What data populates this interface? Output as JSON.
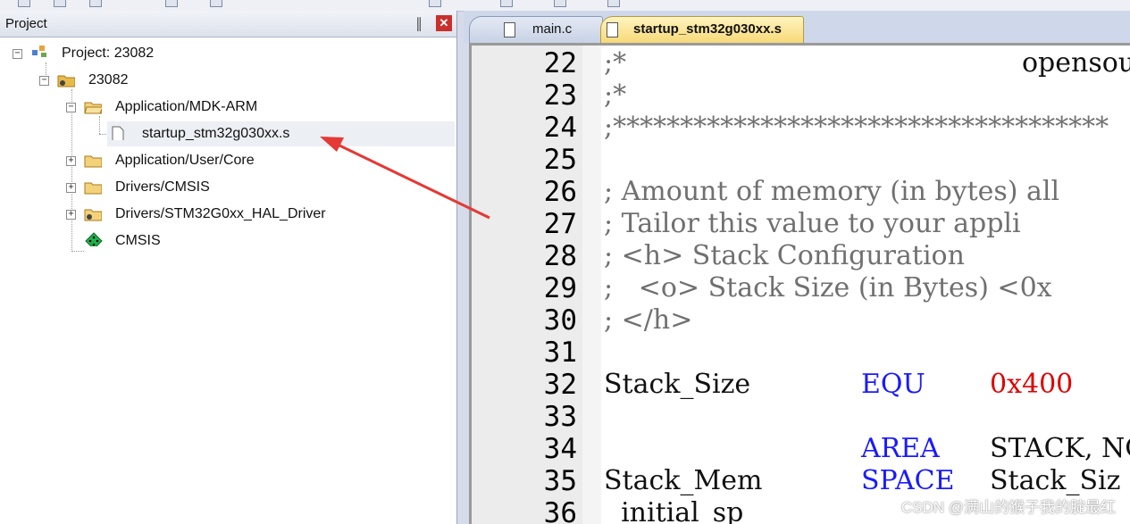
{
  "project_panel": {
    "title": "Project",
    "pin_glyph": "║",
    "close_glyph": "✕",
    "tree": [
      {
        "label": "Project: 23082",
        "icon": "project-icon"
      },
      {
        "label": "23082",
        "icon": "target-folder-icon"
      },
      {
        "label": "Application/MDK-ARM",
        "icon": "open-folder-icon"
      },
      {
        "label": "startup_stm32g030xx.s",
        "icon": "file-icon"
      },
      {
        "label": "Application/User/Core",
        "icon": "folder-icon"
      },
      {
        "label": "Drivers/CMSIS",
        "icon": "folder-icon"
      },
      {
        "label": "Drivers/STM32G0xx_HAL_Driver",
        "icon": "folder-gear-icon"
      },
      {
        "label": "CMSIS",
        "icon": "cmsis-diamond-icon"
      }
    ],
    "expanders": {
      "collapse": "−",
      "expand": "+"
    }
  },
  "editor": {
    "tabs": [
      {
        "label": "main.c",
        "active": false
      },
      {
        "label": "startup_stm32g030xx.s",
        "active": true
      }
    ],
    "lines": [
      {
        "no": "22",
        "parts": [
          ";*",
          "",
          "",
          "opensou"
        ]
      },
      {
        "no": "23",
        "parts": [
          ";*",
          "",
          "",
          ""
        ]
      },
      {
        "no": "24",
        "parts": [
          ";*************************************",
          "",
          "",
          ""
        ]
      },
      {
        "no": "25",
        "parts": [
          "",
          "",
          "",
          ""
        ]
      },
      {
        "no": "26",
        "parts": [
          "; Amount of memory (in bytes) all",
          "",
          "",
          ""
        ]
      },
      {
        "no": "27",
        "parts": [
          "; Tailor this value to your appli",
          "",
          "",
          ""
        ]
      },
      {
        "no": "28",
        "parts": [
          "; <h> Stack Configuration",
          "",
          "",
          ""
        ]
      },
      {
        "no": "29",
        "parts": [
          ";   <o> Stack Size (in Bytes) <0x",
          "",
          "",
          ""
        ]
      },
      {
        "no": "30",
        "parts": [
          "; </h>",
          "",
          "",
          ""
        ]
      },
      {
        "no": "31",
        "parts": [
          "",
          "",
          "",
          ""
        ]
      },
      {
        "no": "32",
        "parts": [
          "Stack_Size",
          "EQU",
          "0x400",
          ""
        ]
      },
      {
        "no": "33",
        "parts": [
          "",
          "",
          "",
          ""
        ]
      },
      {
        "no": "34",
        "parts": [
          "",
          "AREA",
          "STACK, NO",
          ""
        ]
      },
      {
        "no": "35",
        "parts": [
          "Stack_Mem",
          "SPACE",
          "Stack_Siz",
          ""
        ]
      },
      {
        "no": "36",
        "parts": [
          "  initial_sp",
          "",
          "",
          ""
        ]
      }
    ],
    "colors": {
      "comment": "#707070",
      "keyword": "#1a1aff",
      "number": "#e00000"
    }
  },
  "watermark": "CSDN @满山的猴子我的腚最红"
}
